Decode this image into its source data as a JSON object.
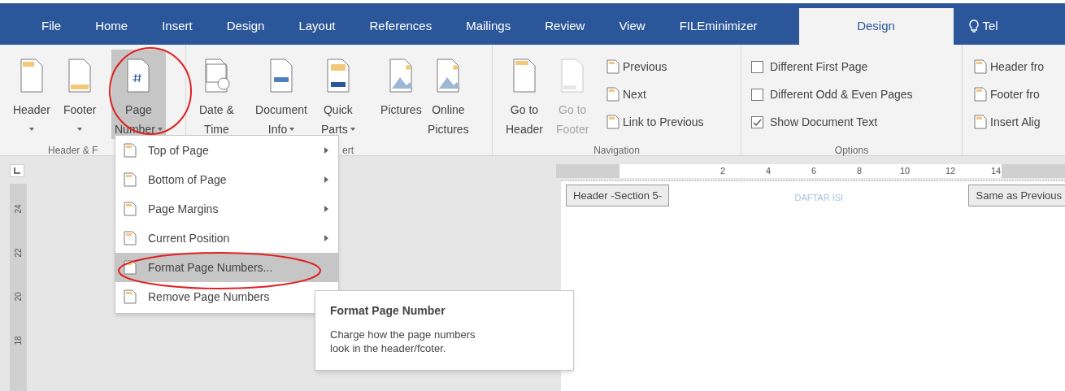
{
  "tabs": [
    {
      "label": "File",
      "selected": false
    },
    {
      "label": "Home",
      "selected": false
    },
    {
      "label": "Insert",
      "selected": false
    },
    {
      "label": "Design",
      "selected": false
    },
    {
      "label": "Layout",
      "selected": false
    },
    {
      "label": "References",
      "selected": false
    },
    {
      "label": "Mailings",
      "selected": false
    },
    {
      "label": "Review",
      "selected": false
    },
    {
      "label": "View",
      "selected": false
    },
    {
      "label": "FILEminimizer",
      "selected": false
    },
    {
      "label": "Design",
      "selected": true
    }
  ],
  "tell_me": "Tel",
  "groups": [
    {
      "label": "Header & F",
      "buttons": [
        {
          "kind": "header",
          "lines": [
            "Header"
          ],
          "caret": true,
          "selected": false,
          "disabled": false
        },
        {
          "kind": "footer",
          "lines": [
            "Footer"
          ],
          "caret": true,
          "selected": false,
          "disabled": false
        },
        {
          "kind": "page-number",
          "lines": [
            "Page",
            "Number"
          ],
          "caret": true,
          "selected": true,
          "disabled": false
        }
      ]
    },
    {
      "label": "ert",
      "buttons": [
        {
          "kind": "date",
          "lines": [
            "Date &",
            "Time"
          ],
          "caret": false,
          "selected": false,
          "disabled": false
        },
        {
          "kind": "doc-info",
          "lines": [
            "Document",
            "Info"
          ],
          "caret": true,
          "selected": false,
          "disabled": false
        },
        {
          "kind": "quick-parts",
          "lines": [
            "Quick",
            "Parts"
          ],
          "caret": true,
          "selected": false,
          "disabled": false
        },
        {
          "kind": "pictures",
          "lines": [
            "Pictures"
          ],
          "caret": false,
          "selected": false,
          "disabled": false
        },
        {
          "kind": "online-pictures",
          "lines": [
            "Online",
            "Pictures"
          ],
          "caret": false,
          "selected": false,
          "disabled": false
        }
      ]
    },
    {
      "label": "Navigation",
      "buttons": [
        {
          "kind": "go-header",
          "lines": [
            "Go to",
            "Header"
          ],
          "caret": false,
          "selected": false,
          "disabled": false
        },
        {
          "kind": "go-footer",
          "lines": [
            "Go to",
            "Footer"
          ],
          "caret": false,
          "selected": false,
          "disabled": true
        }
      ],
      "small": [
        "Previous",
        "Next",
        "Link to Previous"
      ]
    },
    {
      "label": "Options",
      "checks": [
        {
          "label": "Different First Page",
          "checked": false
        },
        {
          "label": "Different Odd & Even Pages",
          "checked": false
        },
        {
          "label": "Show Document Text",
          "checked": true
        }
      ]
    }
  ],
  "position_items": [
    "Header fro",
    "Footer fro",
    "Insert Alig"
  ],
  "menu": [
    {
      "label": "Top of Page",
      "submenu": true,
      "selected": false
    },
    {
      "label": "Bottom of Page",
      "submenu": true,
      "selected": false
    },
    {
      "label": "Page Margins",
      "submenu": true,
      "selected": false
    },
    {
      "label": "Current Position",
      "submenu": true,
      "selected": false
    },
    {
      "label": "Format Page Numbers...",
      "submenu": false,
      "selected": true
    },
    {
      "label": "Remove Page Numbers",
      "selected": false
    }
  ],
  "tooltip": {
    "title": "Format Page Number",
    "description": "Charge how the page numbers\nlook in the header/fcoter."
  },
  "vertical_ruler": [
    "24",
    "22",
    "20",
    "18"
  ],
  "ruler": [
    "2",
    "4",
    "6",
    "8",
    "10",
    "12",
    "14"
  ],
  "page": {
    "header_tag": "Header -Section 5-",
    "heading": "DAFTAR ISI",
    "link_tag": "Same as Previous"
  }
}
